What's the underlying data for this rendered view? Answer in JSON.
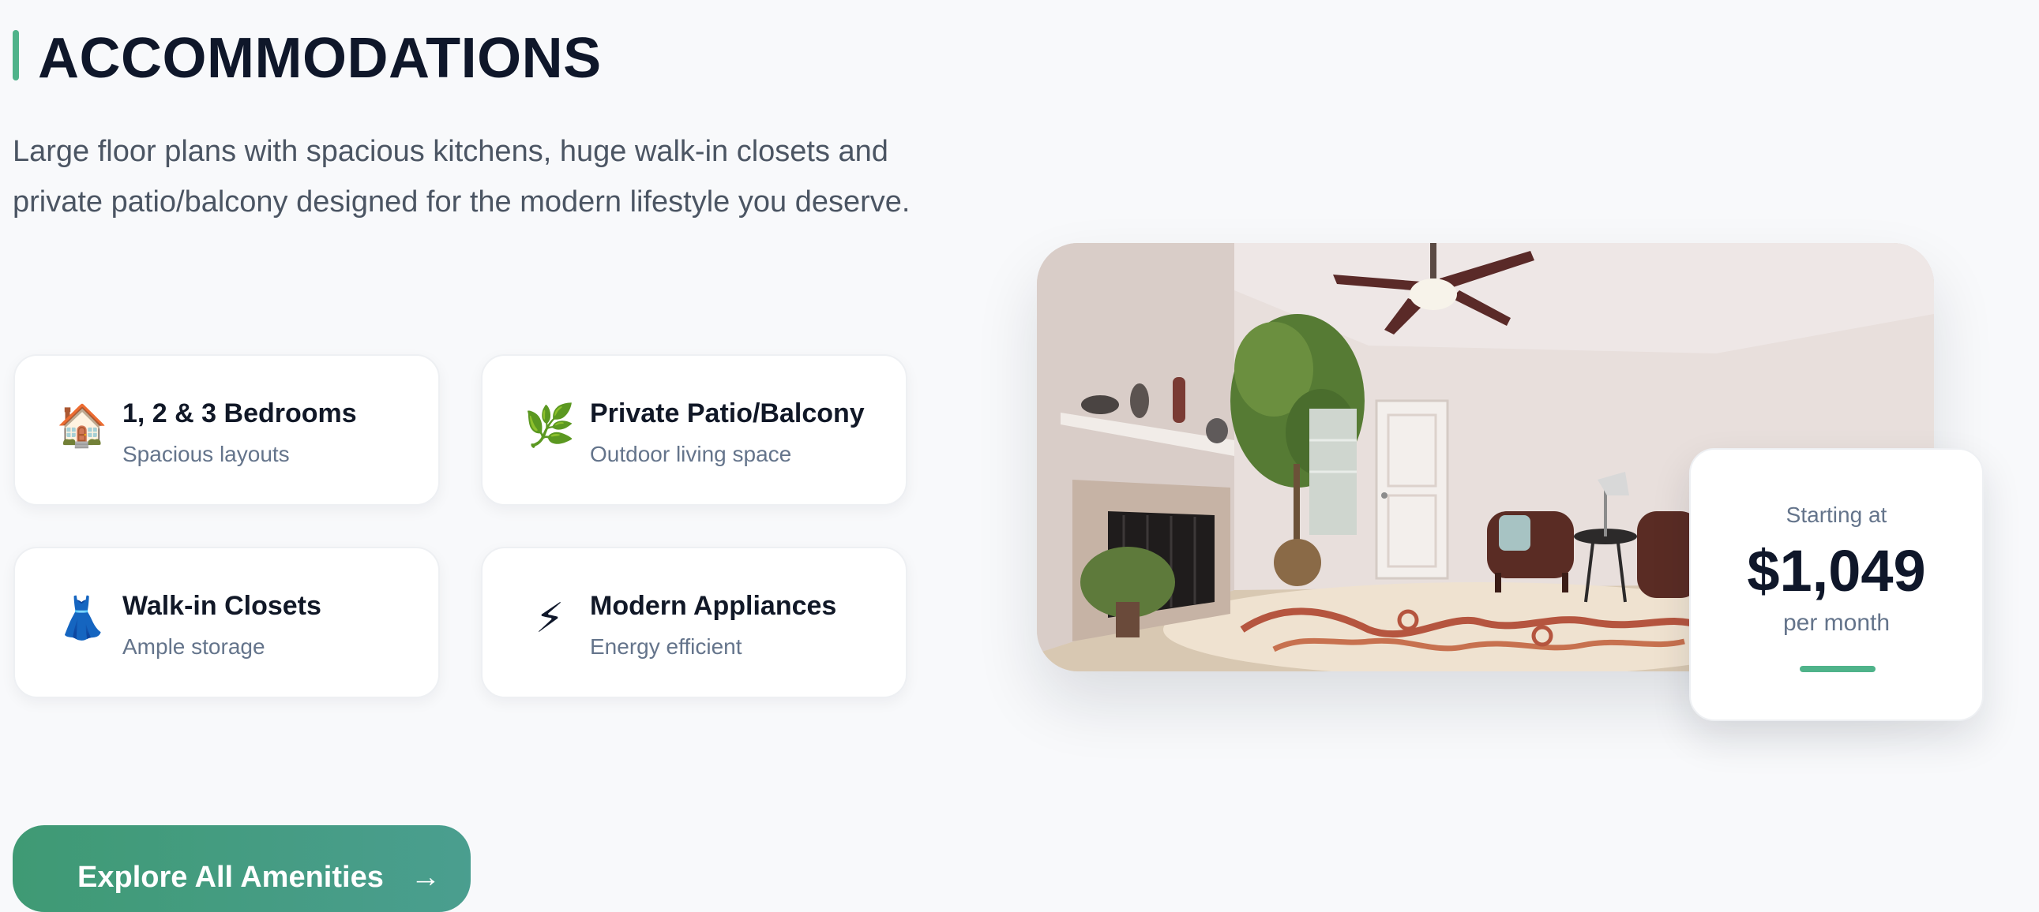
{
  "section": {
    "title": "ACCOMMODATIONS",
    "description": "Large floor plans with spacious kitchens, huge walk-in closets and private patio/balcony designed for the modern lifestyle you deserve."
  },
  "features": [
    {
      "icon": "house-icon",
      "glyph": "🏠",
      "title": "1, 2 & 3 Bedrooms",
      "subtitle": "Spacious layouts"
    },
    {
      "icon": "herb-icon",
      "glyph": "🌿",
      "title": "Private Patio/Balcony",
      "subtitle": "Outdoor living space"
    },
    {
      "icon": "dress-icon",
      "glyph": "👗",
      "title": "Walk-in Closets",
      "subtitle": "Ample storage"
    },
    {
      "icon": "lightning-icon",
      "glyph": "⚡",
      "title": "Modern Appliances",
      "subtitle": "Energy efficient"
    }
  ],
  "pricing": {
    "label": "Starting at",
    "amount": "$1,049",
    "period": "per month"
  },
  "cta": {
    "label": "Explore All Amenities",
    "arrow": "→"
  },
  "colors": {
    "accent": "#4fb38a",
    "button_gradient_start": "#3f9a74",
    "button_gradient_end": "#4a9e8f",
    "heading": "#0f172a",
    "muted_text": "#64748b",
    "background": "#f8f9fb"
  }
}
